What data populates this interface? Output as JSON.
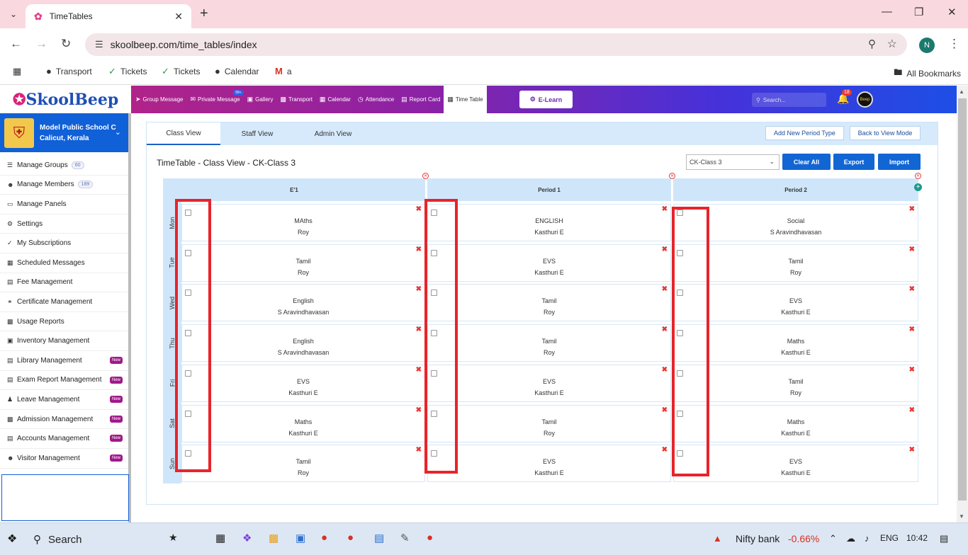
{
  "browser": {
    "tab_title": "TimeTables",
    "url": "skoolbeep.com/time_tables/index",
    "profile_initial": "N",
    "bookmarks": [
      {
        "label": "Transport",
        "icon": "globe-icon"
      },
      {
        "label": "Tickets",
        "icon": "ticket-icon"
      },
      {
        "label": "Tickets",
        "icon": "ticket-icon"
      },
      {
        "label": "Calendar",
        "icon": "globe-icon"
      },
      {
        "label": "a",
        "icon": "gmail-icon"
      }
    ],
    "all_bookmarks": "All Bookmarks"
  },
  "app": {
    "logo": "SkoolBeep",
    "menu": [
      {
        "label": "Group Message",
        "icon": "send-icon"
      },
      {
        "label": "Private Message",
        "icon": "mail-icon",
        "badge": "99+"
      },
      {
        "label": "Gallery",
        "icon": "image-icon"
      },
      {
        "label": "Transport",
        "icon": "bus-icon"
      },
      {
        "label": "Calendar",
        "icon": "calendar-icon"
      },
      {
        "label": "Attendance",
        "icon": "clock-icon"
      },
      {
        "label": "Report Card",
        "icon": "document-icon"
      },
      {
        "label": "Time Table",
        "icon": "table-icon",
        "active": true
      }
    ],
    "elearn": "E-Learn",
    "search_placeholder": "Search...",
    "notification_count": "18",
    "avatar_text": "Beep"
  },
  "sidebar": {
    "school_name": "Model Public School C",
    "school_location": "Calicut, Kerala",
    "items": [
      {
        "label": "Manage Groups",
        "count": "60",
        "icon": "list-icon"
      },
      {
        "label": "Manage Members",
        "count": "189",
        "icon": "users-icon"
      },
      {
        "label": "Manage Panels",
        "icon": "monitor-icon"
      },
      {
        "label": "Settings",
        "icon": "gear-icon"
      },
      {
        "label": "My Subscriptions",
        "icon": "check-icon"
      },
      {
        "label": "Scheduled Messages",
        "icon": "calendar-icon"
      },
      {
        "label": "Fee Management",
        "icon": "receipt-icon"
      },
      {
        "label": "Certificate Management",
        "icon": "certificate-icon"
      },
      {
        "label": "Usage Reports",
        "icon": "bar-chart-icon"
      },
      {
        "label": "Inventory Management",
        "icon": "box-icon"
      },
      {
        "label": "Library Management",
        "icon": "book-icon",
        "new": "New"
      },
      {
        "label": "Exam Report Management",
        "icon": "document-icon",
        "new": "New"
      },
      {
        "label": "Leave Management",
        "icon": "person-icon",
        "new": "New"
      },
      {
        "label": "Admission Management",
        "icon": "id-card-icon",
        "new": "New"
      },
      {
        "label": "Accounts Management",
        "icon": "document-icon",
        "new": "New"
      },
      {
        "label": "Visitor Management",
        "icon": "users-icon",
        "new": "New"
      }
    ]
  },
  "timetable": {
    "tabs": [
      "Class View",
      "Staff View",
      "Admin View"
    ],
    "add_period_type": "Add New Period Type",
    "back_to_view": "Back to View Mode",
    "heading": "TimeTable - Class View - CK-Class 3",
    "class_select": "CK-Class 3",
    "buttons": {
      "clear_all": "Clear All",
      "export": "Export",
      "import": "Import"
    },
    "columns": [
      "E'1",
      "Period 1",
      "Period 2"
    ],
    "days": [
      "Mon",
      "Tue",
      "Wed",
      "Thu",
      "Fri",
      "Sat",
      "Sun"
    ],
    "cells": [
      [
        {
          "subject": "MAths",
          "teacher": "Roy"
        },
        {
          "subject": "ENGLISH",
          "teacher": "Kasthuri E"
        },
        {
          "subject": "Social",
          "teacher": "S Aravindhavasan"
        }
      ],
      [
        {
          "subject": "Tamil",
          "teacher": "Roy"
        },
        {
          "subject": "EVS",
          "teacher": "Kasthuri E"
        },
        {
          "subject": "Tamil",
          "teacher": "Roy"
        }
      ],
      [
        {
          "subject": "English",
          "teacher": "S Aravindhavasan"
        },
        {
          "subject": "Tamil",
          "teacher": "Roy"
        },
        {
          "subject": "EVS",
          "teacher": "Kasthuri E"
        }
      ],
      [
        {
          "subject": "English",
          "teacher": "S Aravindhavasan"
        },
        {
          "subject": "Tamil",
          "teacher": "Roy"
        },
        {
          "subject": "Maths",
          "teacher": "Kasthuri E"
        }
      ],
      [
        {
          "subject": "EVS",
          "teacher": "Kasthuri E"
        },
        {
          "subject": "EVS",
          "teacher": "Kasthuri E"
        },
        {
          "subject": "Tamil",
          "teacher": "Roy"
        }
      ],
      [
        {
          "subject": "Maths",
          "teacher": "Kasthuri E"
        },
        {
          "subject": "Tamil",
          "teacher": "Roy"
        },
        {
          "subject": "Maths",
          "teacher": "Kasthuri E"
        }
      ],
      [
        {
          "subject": "Tamil",
          "teacher": "Roy"
        },
        {
          "subject": "EVS",
          "teacher": "Kasthuri E"
        },
        {
          "subject": "EVS",
          "teacher": "Kasthuri E"
        }
      ]
    ]
  },
  "taskbar": {
    "search": "Search",
    "stock_name": "Nifty bank",
    "stock_change": "-0.66%",
    "language": "ENG",
    "time": "10:42"
  },
  "colors": {
    "accent": "#1266d4",
    "highlight": "#e8242b",
    "stock_negative": "#d93025"
  }
}
